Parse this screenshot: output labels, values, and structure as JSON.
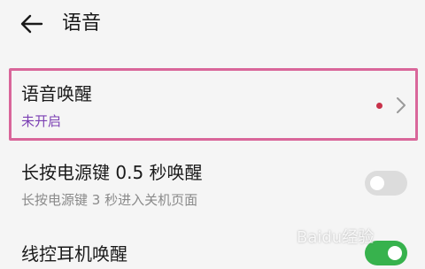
{
  "header": {
    "back_icon": "arrow-left-icon",
    "title": "语音"
  },
  "settings": {
    "voice_wakeup": {
      "title": "语音唤醒",
      "status": "未开启",
      "status_color": "#7b3fb3",
      "dot_color": "#c8324a",
      "highlight_color": "#d9669a",
      "chevron_icon": "chevron-right-icon"
    },
    "power_key_wakeup": {
      "title": "长按电源键 0.5 秒唤醒",
      "subtitle": "长按电源键 3 秒进入关机页面",
      "enabled": false
    },
    "wired_earphone_wakeup": {
      "title": "线控耳机唤醒",
      "enabled": true,
      "toggle_color": "#37b24d"
    }
  },
  "watermark": {
    "text": "Baidu经验"
  }
}
